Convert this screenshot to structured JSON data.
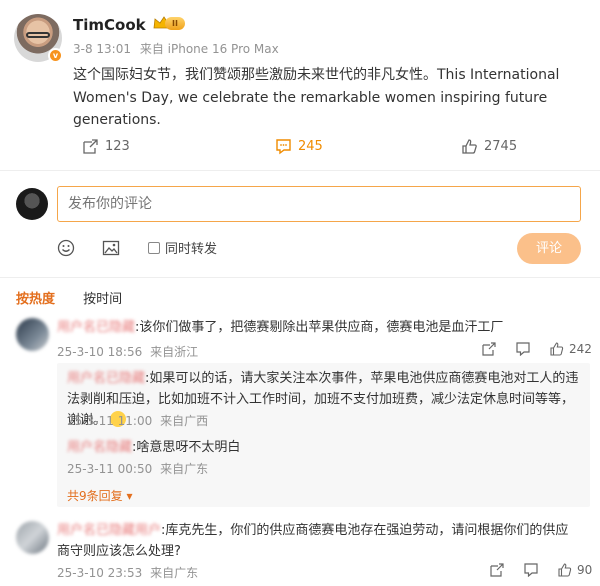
{
  "post": {
    "username": "TimCook",
    "vip_level": "II",
    "date": "3-8 13:01",
    "source": "来自 iPhone 16 Pro Max",
    "text": "这个国际妇女节，我们赞颂那些激励未来世代的非凡女性。This International Women's Day, we celebrate the remarkable women inspiring future generations.",
    "repost_count": "123",
    "comment_count": "245",
    "like_count": "2745",
    "icons": [
      "verified-icon",
      "crown-icon",
      "repost-icon",
      "comment-icon",
      "like-icon"
    ]
  },
  "composer": {
    "placeholder": "发布你的评论",
    "repost_label": "同时转发",
    "submit_label": "评论",
    "icons": [
      "emoji-icon",
      "image-icon"
    ]
  },
  "sort": {
    "tabs": [
      {
        "label": "按热度",
        "active": true
      },
      {
        "label": "按时间",
        "active": false
      }
    ]
  },
  "comments": [
    {
      "name": "用户名已隐藏",
      "text": ":该你们做事了，把德赛剔除出苹果供应商，德赛电池是血汗工厂",
      "date": "25-3-10 18:56",
      "location": "来自浙江",
      "likes": "242"
    },
    {
      "name": "用户名已隐藏用户",
      "text": ":库克先生，你们的供应商德赛电池存在强迫劳动，请问根据你们的供应商守则应该怎么处理?",
      "date": "25-3-10 23:53",
      "location": "来自广东",
      "likes": "90"
    }
  ],
  "replies": [
    {
      "name": "用户名已隐藏",
      "text": ":如果可以的话，请大家关注本次事件，苹果电池供应商德赛电池对工人的违法剥削和压迫，比如加班不计入工作时间，加班不支付加班费，减少法定休息时间等等，谢谢。",
      "date": "25-3-11 11:00",
      "location": "来自广西"
    },
    {
      "name": "用户名隐藏",
      "text": ":啥意思呀不太明白",
      "date": "25-3-11 00:50",
      "location": "来自广东"
    }
  ],
  "more_replies_label": "共9条回复",
  "colors": {
    "accent": "#e36f1e",
    "comment_count": "#f08c00",
    "submit_button": "#fbc08a",
    "input_border": "#f5a64a"
  }
}
